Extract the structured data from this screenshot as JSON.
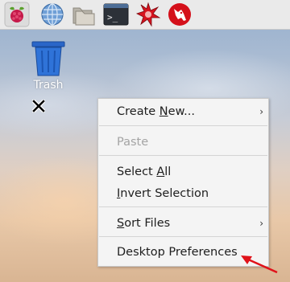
{
  "taskbar": {
    "items": [
      {
        "name": "raspberry-menu-icon"
      },
      {
        "name": "web-browser-icon"
      },
      {
        "name": "file-manager-icon"
      },
      {
        "name": "terminal-icon"
      },
      {
        "name": "mathematica-icon"
      },
      {
        "name": "wolfram-icon"
      }
    ],
    "terminal_prompt": ">_"
  },
  "desktop": {
    "trash": {
      "label": "Trash",
      "icon": "trash-can-icon"
    }
  },
  "context_menu": {
    "items": [
      {
        "pre": "Create ",
        "u": "N",
        "post": "ew...",
        "submenu": true,
        "disabled": false
      },
      {
        "pre": "Paste",
        "u": "",
        "post": "",
        "submenu": false,
        "disabled": true
      },
      {
        "pre": "Select ",
        "u": "A",
        "post": "ll",
        "submenu": false,
        "disabled": false
      },
      {
        "pre": "",
        "u": "I",
        "post": "nvert Selection",
        "submenu": false,
        "disabled": false
      },
      {
        "pre": "",
        "u": "S",
        "post": "ort Files",
        "submenu": true,
        "disabled": false
      },
      {
        "pre": "Desktop Preferences",
        "u": "",
        "post": "",
        "submenu": false,
        "disabled": false
      }
    ]
  },
  "colors": {
    "annotation_arrow": "#e0121a",
    "menu_bg": "#f4f4f4",
    "disabled_text": "#a4a4a4"
  }
}
